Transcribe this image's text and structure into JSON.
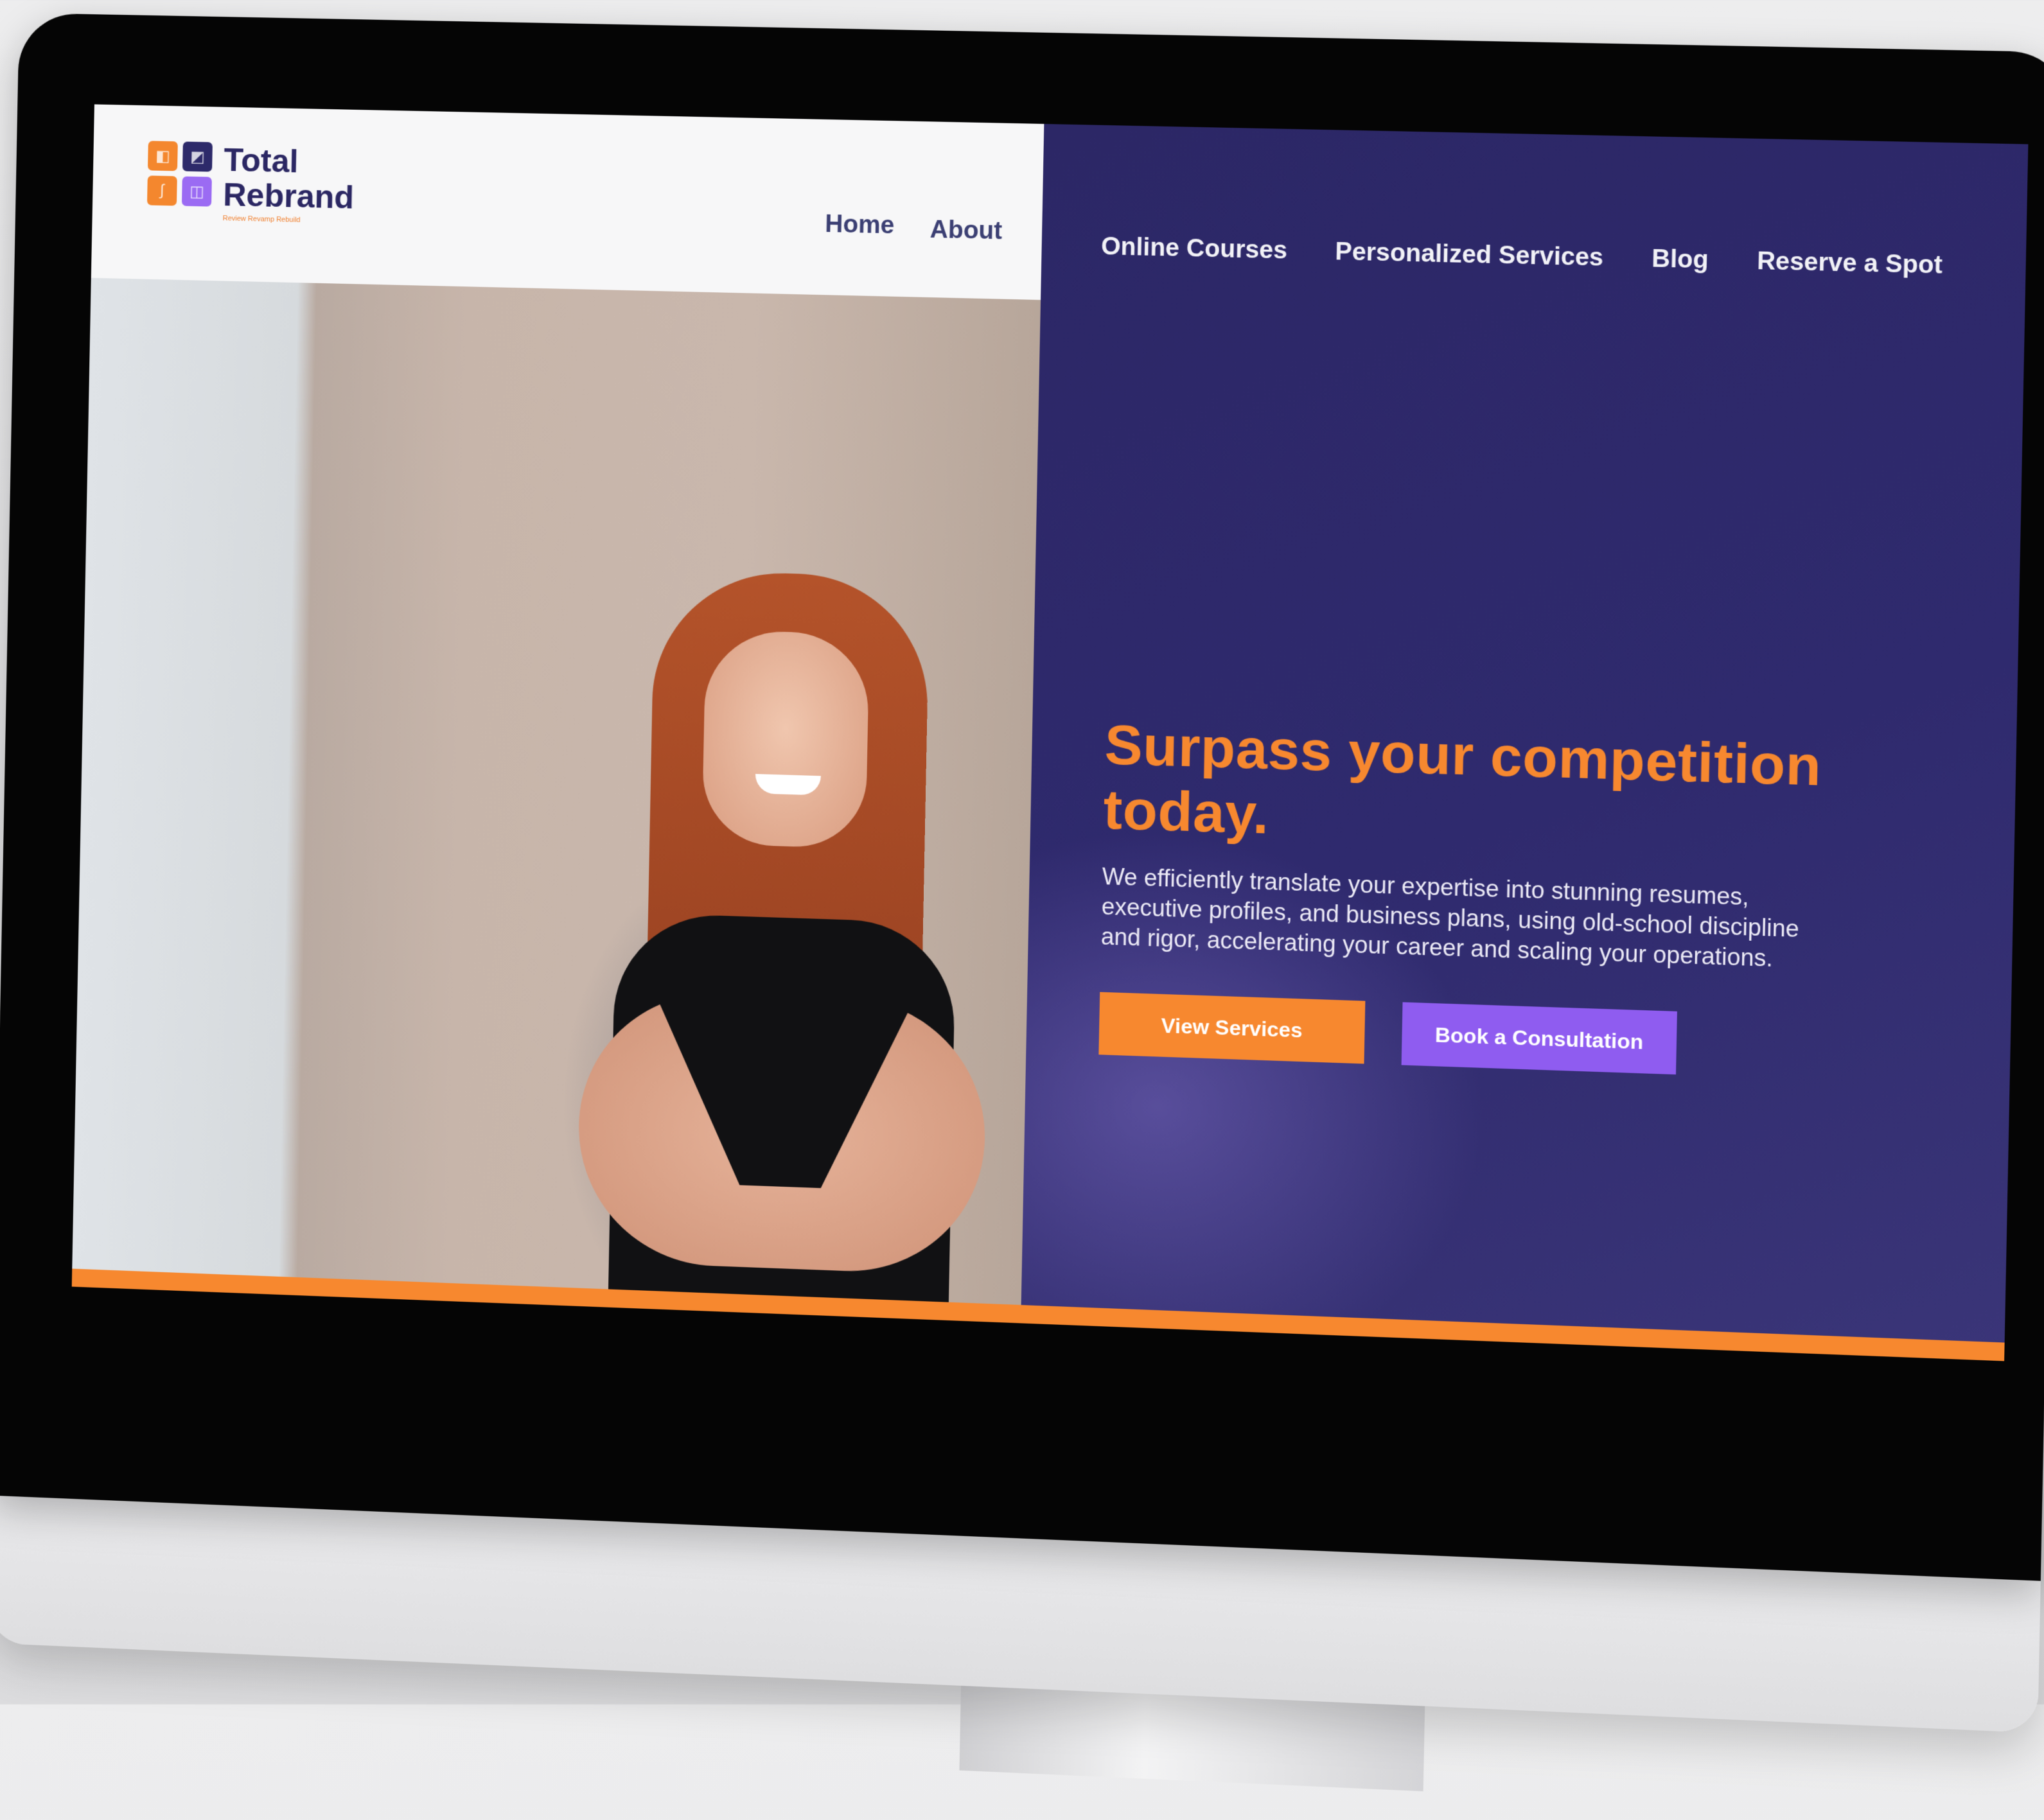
{
  "brand": {
    "line1": "Total",
    "line2": "Rebrand",
    "tagline": "Review Revamp Rebuild",
    "tile_colors": [
      "#f4872e",
      "#2d2a6a",
      "#f4872e",
      "#9b6bf3"
    ]
  },
  "nav_left": {
    "home": "Home",
    "about": "About"
  },
  "nav_right": {
    "items": [
      "Online Courses",
      "Personalized Services",
      "Blog",
      "Reserve a Spot"
    ]
  },
  "hero": {
    "title": "Surpass your competition today.",
    "description": "We efficiently translate your expertise into stunning resumes, executive profiles, and business plans, using old-school discipline and rigor, accelerating your career and scaling your operations.",
    "primary_button": "View Services",
    "secondary_button": "Book a Consultation"
  },
  "colors": {
    "accent_orange": "#f7882f",
    "accent_purple": "#8f5cf0",
    "panel_navy": "#2f2a6e"
  }
}
